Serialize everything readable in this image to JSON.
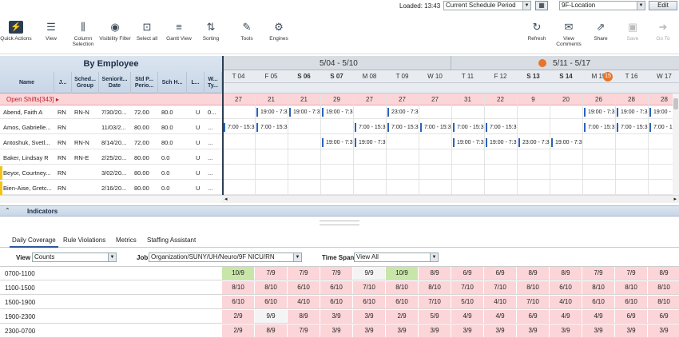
{
  "topbar": {
    "loaded": "Loaded: 13:43",
    "period": "Current Schedule Period",
    "location": "9F-Location",
    "edit_label": "Edit"
  },
  "toolbar": {
    "quick_actions": "Quick Actions",
    "view": "View",
    "column_selection": "Column Selection",
    "visibility_filter": "Visibility Filter",
    "select_all": "Select all",
    "gantt_view": "Gantt View",
    "sorting": "Sorting",
    "tools": "Tools",
    "engines": "Engines",
    "refresh": "Refresh",
    "view_comments": "View Comments",
    "share": "Share",
    "save": "Save",
    "go_to": "Go To"
  },
  "employee_panel": {
    "title": "By Employee",
    "columns": [
      "Name",
      "J...",
      "Sched... Group",
      "Seniorit... Date",
      "Std P... Perio...",
      "Sch H...",
      "L...",
      "W... Ty..."
    ]
  },
  "weeks": [
    "5/04 - 5/10",
    "5/11 - 5/17"
  ],
  "week_badge": "15",
  "days": [
    "T 04",
    "F 05",
    "S 06",
    "S 07",
    "M 08",
    "T 09",
    "W 10",
    "T 11",
    "F 12",
    "S 13",
    "S 14",
    "M 15",
    "T 16",
    "W 17"
  ],
  "open_shifts": {
    "label": "Open Shifts[343]",
    "counts": [
      "27",
      "21",
      "21",
      "29",
      "27",
      "27",
      "27",
      "31",
      "22",
      "9",
      "20",
      "26",
      "28",
      "28"
    ]
  },
  "employees": [
    {
      "name": "Abend, Faith A",
      "job": "RN",
      "group": "RN-N",
      "seniority": "7/30/20...",
      "std": "72.00",
      "sch": "80.0",
      "l": "",
      "w": "U",
      "w2": "0...",
      "shifts": [
        null,
        "19:00 - 7:3",
        "19:00 - 7:3",
        "19:00 - 7:3",
        null,
        "23:00 - 7:3",
        null,
        null,
        null,
        null,
        null,
        "19:00 - 7:3",
        "19:00 - 7:3",
        "19:00 - 7:3"
      ]
    },
    {
      "name": "Amos, Gabrielle...",
      "job": "RN",
      "group": "",
      "seniority": "11/03/2...",
      "std": "80.00",
      "sch": "80.0",
      "l": "",
      "w": "U",
      "w2": "...",
      "shifts": [
        "7:00 - 15:3",
        "7:00 - 15:3",
        null,
        null,
        "7:00 - 15:3",
        "7:00 - 15:3",
        "7:00 - 15:3",
        "7:00 - 15:3",
        "7:00 - 15:3",
        null,
        null,
        "7:00 - 15:3",
        "7:00 - 15:3",
        "7:00 - 15:3"
      ]
    },
    {
      "name": "Antoshuk, Svetl...",
      "job": "RN",
      "group": "RN-N",
      "seniority": "8/14/20...",
      "std": "72.00",
      "sch": "80.0",
      "l": "",
      "w": "U",
      "w2": "...",
      "shifts": [
        null,
        null,
        null,
        "19:00 - 7:3",
        "19:00 - 7:3",
        null,
        null,
        "19:00 - 7:3",
        "19:00 - 7:3",
        "23:00 - 7:3",
        "19:00 - 7:3",
        null,
        null,
        null
      ]
    },
    {
      "name": "Baker, Lindsay R",
      "job": "RN",
      "group": "RN-E",
      "seniority": "2/25/20...",
      "std": "80.00",
      "sch": "0.0",
      "l": "",
      "w": "U",
      "w2": "...",
      "shifts": [
        null,
        null,
        null,
        null,
        null,
        null,
        null,
        null,
        null,
        null,
        null,
        null,
        null,
        null
      ]
    },
    {
      "name": "Beyor, Courtney...",
      "job": "RN",
      "group": "",
      "seniority": "3/02/20...",
      "std": "80.00",
      "sch": "0.0",
      "l": "",
      "w": "U",
      "w2": "...",
      "shifts": [
        null,
        null,
        null,
        null,
        null,
        null,
        null,
        null,
        null,
        null,
        null,
        null,
        null,
        null
      ]
    },
    {
      "name": "Bien-Aise, Gretc...",
      "job": "RN",
      "group": "",
      "seniority": "2/16/20...",
      "std": "80.00",
      "sch": "0.0",
      "l": "",
      "w": "U",
      "w2": "...",
      "shifts": [
        null,
        null,
        null,
        null,
        null,
        null,
        null,
        null,
        null,
        null,
        null,
        null,
        null,
        null
      ]
    }
  ],
  "indicators": {
    "label": "Indicators"
  },
  "tabs": [
    "Daily Coverage",
    "Rule Violations",
    "Metrics",
    "Staffing Assistant"
  ],
  "filters": {
    "view_label": "View",
    "view_value": "Counts",
    "job_label": "Job",
    "job_value": "Organization/SUNY/UH/Neuro/9F NICU/RN",
    "span_label": "Time Span",
    "span_value": "View All"
  },
  "coverage": [
    {
      "time": "0700-1100",
      "cells": [
        "10/9",
        "7/9",
        "7/9",
        "7/9",
        "9/9",
        "10/9",
        "8/9",
        "6/9",
        "6/9",
        "8/9",
        "8/9",
        "7/9",
        "7/9",
        "8/9"
      ],
      "status": [
        "over",
        "under",
        "under",
        "under",
        "ok",
        "over",
        "under",
        "under",
        "under",
        "under",
        "under",
        "under",
        "under",
        "under"
      ]
    },
    {
      "time": "1100-1500",
      "cells": [
        "8/10",
        "8/10",
        "6/10",
        "6/10",
        "7/10",
        "8/10",
        "8/10",
        "7/10",
        "7/10",
        "8/10",
        "6/10",
        "8/10",
        "8/10",
        "8/10"
      ],
      "status": [
        "under",
        "under",
        "under",
        "under",
        "under",
        "under",
        "under",
        "under",
        "under",
        "under",
        "under",
        "under",
        "under",
        "under"
      ]
    },
    {
      "time": "1500-1900",
      "cells": [
        "6/10",
        "6/10",
        "4/10",
        "6/10",
        "6/10",
        "6/10",
        "7/10",
        "5/10",
        "4/10",
        "7/10",
        "4/10",
        "6/10",
        "6/10",
        "8/10"
      ],
      "status": [
        "under",
        "under",
        "under",
        "under",
        "under",
        "under",
        "under",
        "under",
        "under",
        "under",
        "under",
        "under",
        "under",
        "under"
      ]
    },
    {
      "time": "1900-2300",
      "cells": [
        "2/9",
        "9/9",
        "8/9",
        "3/9",
        "3/9",
        "2/9",
        "5/9",
        "4/9",
        "4/9",
        "6/9",
        "4/9",
        "4/9",
        "6/9",
        "6/9"
      ],
      "status": [
        "under",
        "ok",
        "under",
        "under",
        "under",
        "under",
        "under",
        "under",
        "under",
        "under",
        "under",
        "under",
        "under",
        "under"
      ]
    },
    {
      "time": "2300-0700",
      "cells": [
        "2/9",
        "8/9",
        "7/9",
        "3/9",
        "3/9",
        "3/9",
        "3/9",
        "3/9",
        "3/9",
        "3/9",
        "3/9",
        "3/9",
        "3/9",
        "3/9"
      ],
      "status": [
        "under",
        "under",
        "under",
        "under",
        "under",
        "under",
        "under",
        "under",
        "under",
        "under",
        "under",
        "under",
        "under",
        "under"
      ]
    }
  ],
  "colors": {
    "over": "#c8e6a8",
    "ok": "#f4f4f4",
    "under": "#fbd5d8",
    "accent": "#2b3d52",
    "badge": "#e8742a"
  }
}
